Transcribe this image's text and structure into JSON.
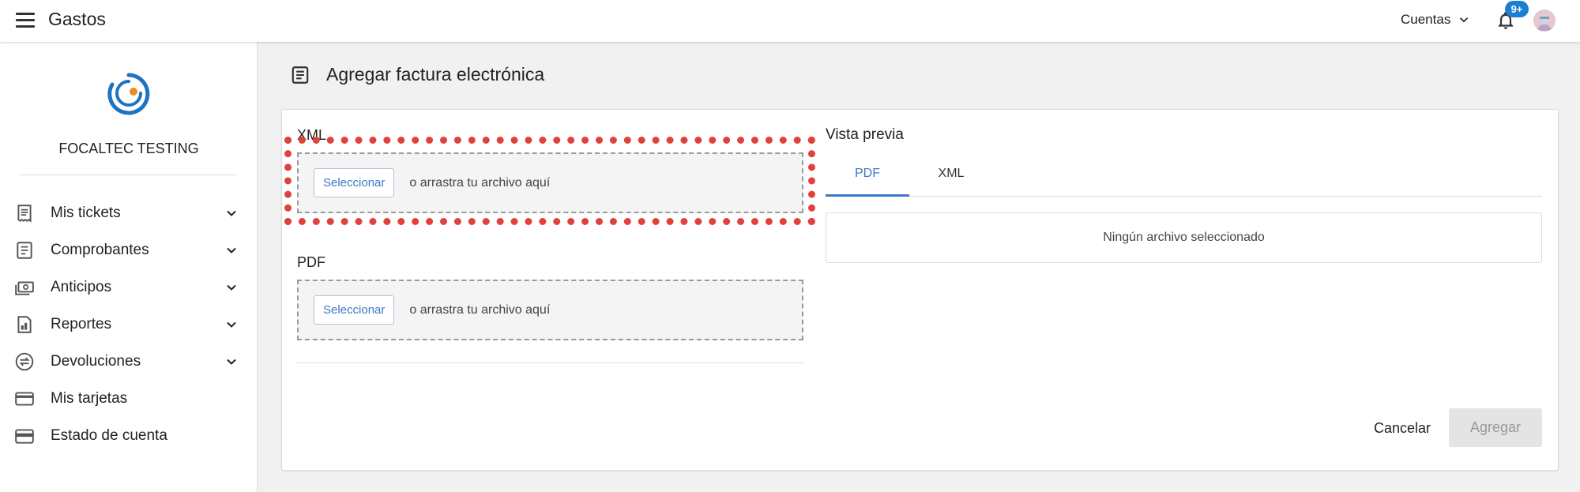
{
  "header": {
    "title": "Gastos",
    "accounts_label": "Cuentas",
    "notifications_badge": "9+"
  },
  "sidebar": {
    "org_name": "FOCALTEC TESTING",
    "items": [
      {
        "label": "Mis tickets",
        "icon": "receipt-icon",
        "expandable": true
      },
      {
        "label": "Comprobantes",
        "icon": "document-icon",
        "expandable": true
      },
      {
        "label": "Anticipos",
        "icon": "cash-icon",
        "expandable": true
      },
      {
        "label": "Reportes",
        "icon": "report-icon",
        "expandable": true
      },
      {
        "label": "Devoluciones",
        "icon": "exchange-icon",
        "expandable": true
      },
      {
        "label": "Mis tarjetas",
        "icon": "credit-card-icon",
        "expandable": false
      },
      {
        "label": "Estado de cuenta",
        "icon": "wallet-icon",
        "expandable": false
      }
    ]
  },
  "main": {
    "title": "Agregar factura electrónica",
    "xml": {
      "label": "XML",
      "button_label": "Seleccionar",
      "hint": "o arrastra tu archivo aquí"
    },
    "pdf": {
      "label": "PDF",
      "button_label": "Seleccionar",
      "hint": "o arrastra tu archivo aquí"
    },
    "preview": {
      "title": "Vista previa",
      "tabs": [
        {
          "label": "PDF",
          "active": true
        },
        {
          "label": "XML",
          "active": false
        }
      ],
      "empty_message": "Ningún archivo seleccionado"
    },
    "actions": {
      "cancel_label": "Cancelar",
      "add_label": "Agregar"
    }
  },
  "colors": {
    "accent": "#3a78c3",
    "badge": "#1a7fd0",
    "highlight": "#e0423b"
  }
}
